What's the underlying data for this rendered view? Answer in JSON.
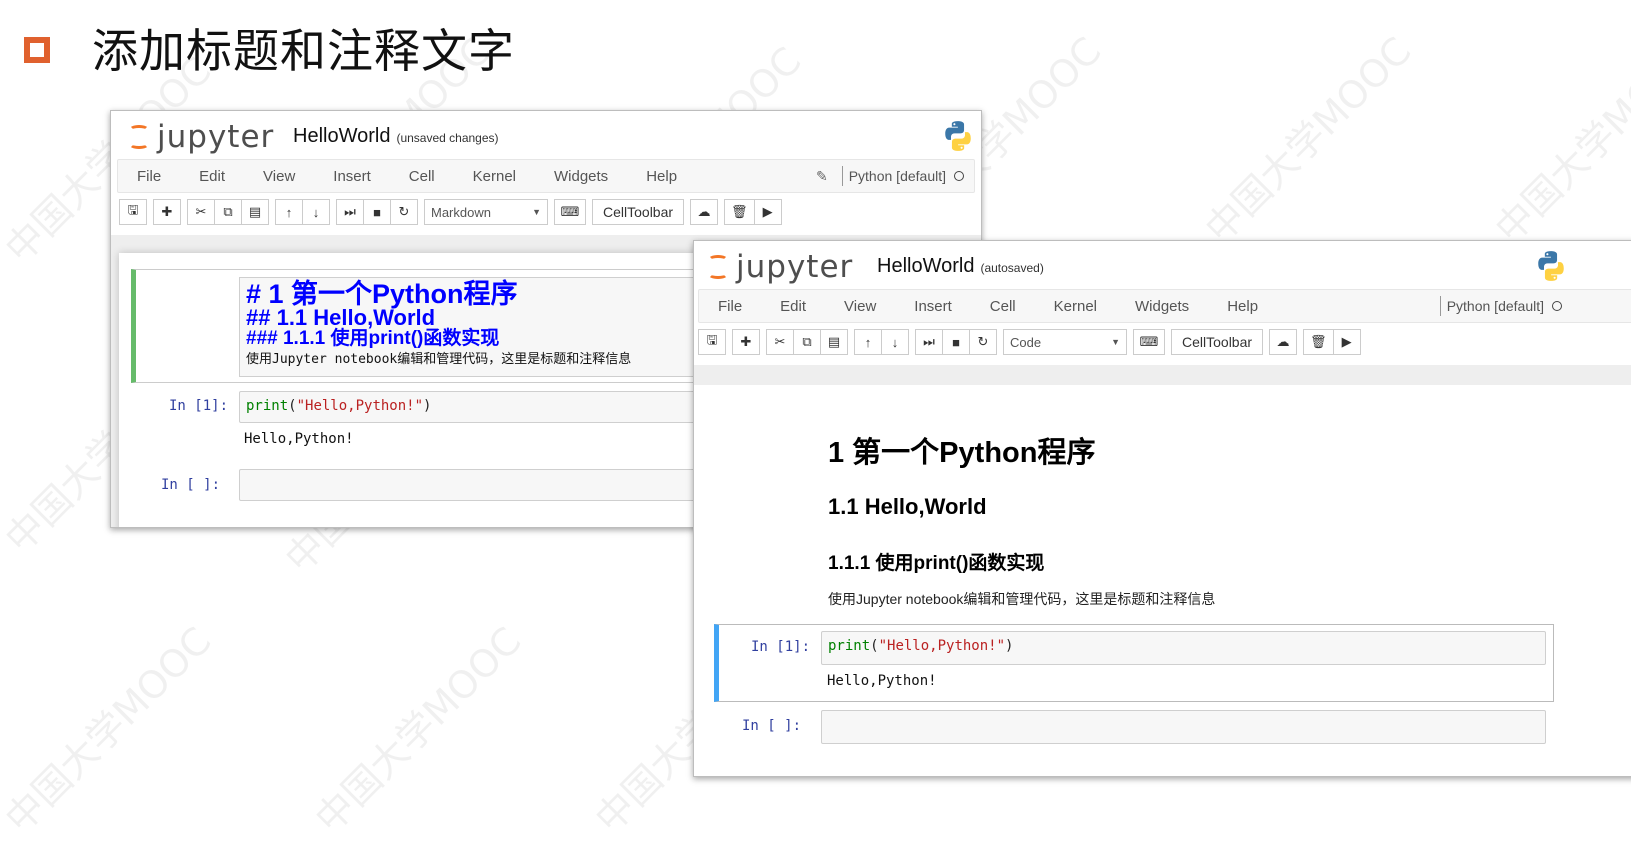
{
  "slide": {
    "title": "添加标题和注释文字"
  },
  "watermark": "中国大学MOOC",
  "logo_word": "jupyter",
  "menu": [
    "File",
    "Edit",
    "View",
    "Insert",
    "Cell",
    "Kernel",
    "Widgets",
    "Help"
  ],
  "kernel_name": "Python [default]",
  "toolbar": {
    "icons": [
      "save-icon",
      "plus-icon",
      "cut-icon",
      "copy-icon",
      "paste-icon",
      "arrow-up-icon",
      "arrow-down-icon",
      "step-forward-icon",
      "stop-icon",
      "restart-icon"
    ],
    "celltoolbar_label": "CellToolbar"
  },
  "left_window": {
    "notebook_name": "HelloWorld",
    "status": "(unsaved changes)",
    "cell_type": "Markdown",
    "markdown_source": {
      "line1": "# 1 第一个Python程序",
      "line2": "## 1.1 Hello,World",
      "line3": "### 1.1.1 使用print()函数实现",
      "line4": "使用Jupyter notebook编辑和管理代码，这里是标题和注释信息"
    },
    "code_prompt": "In  [1]:",
    "code_fn": "print",
    "code_open": "(",
    "code_str": "\"Hello,Python!\"",
    "code_close": ")",
    "output": "Hello,Python!",
    "empty_prompt": "In  [ ]:"
  },
  "right_window": {
    "notebook_name": "HelloWorld",
    "status": "(autosaved)",
    "cell_type": "Code",
    "rendered": {
      "h1": "1 第一个Python程序",
      "h2": "1.1 Hello,World",
      "h3": "1.1.1 使用print()函数实现",
      "p": "使用Jupyter notebook编辑和管理代码，这里是标题和注释信息"
    },
    "code_prompt": "In  [1]:",
    "code_fn": "print",
    "code_open": "(",
    "code_str": "\"Hello,Python!\"",
    "code_close": ")",
    "output": "Hello,Python!",
    "empty_prompt": "In  [ ]:"
  },
  "colors": {
    "accent_orange": "#e0612e",
    "jupyter_orange": "#f37626",
    "heading_blue": "#0000ff",
    "prompt_blue": "#303f9f",
    "edit_green": "#66bb6a",
    "select_blue": "#42a5f5"
  }
}
